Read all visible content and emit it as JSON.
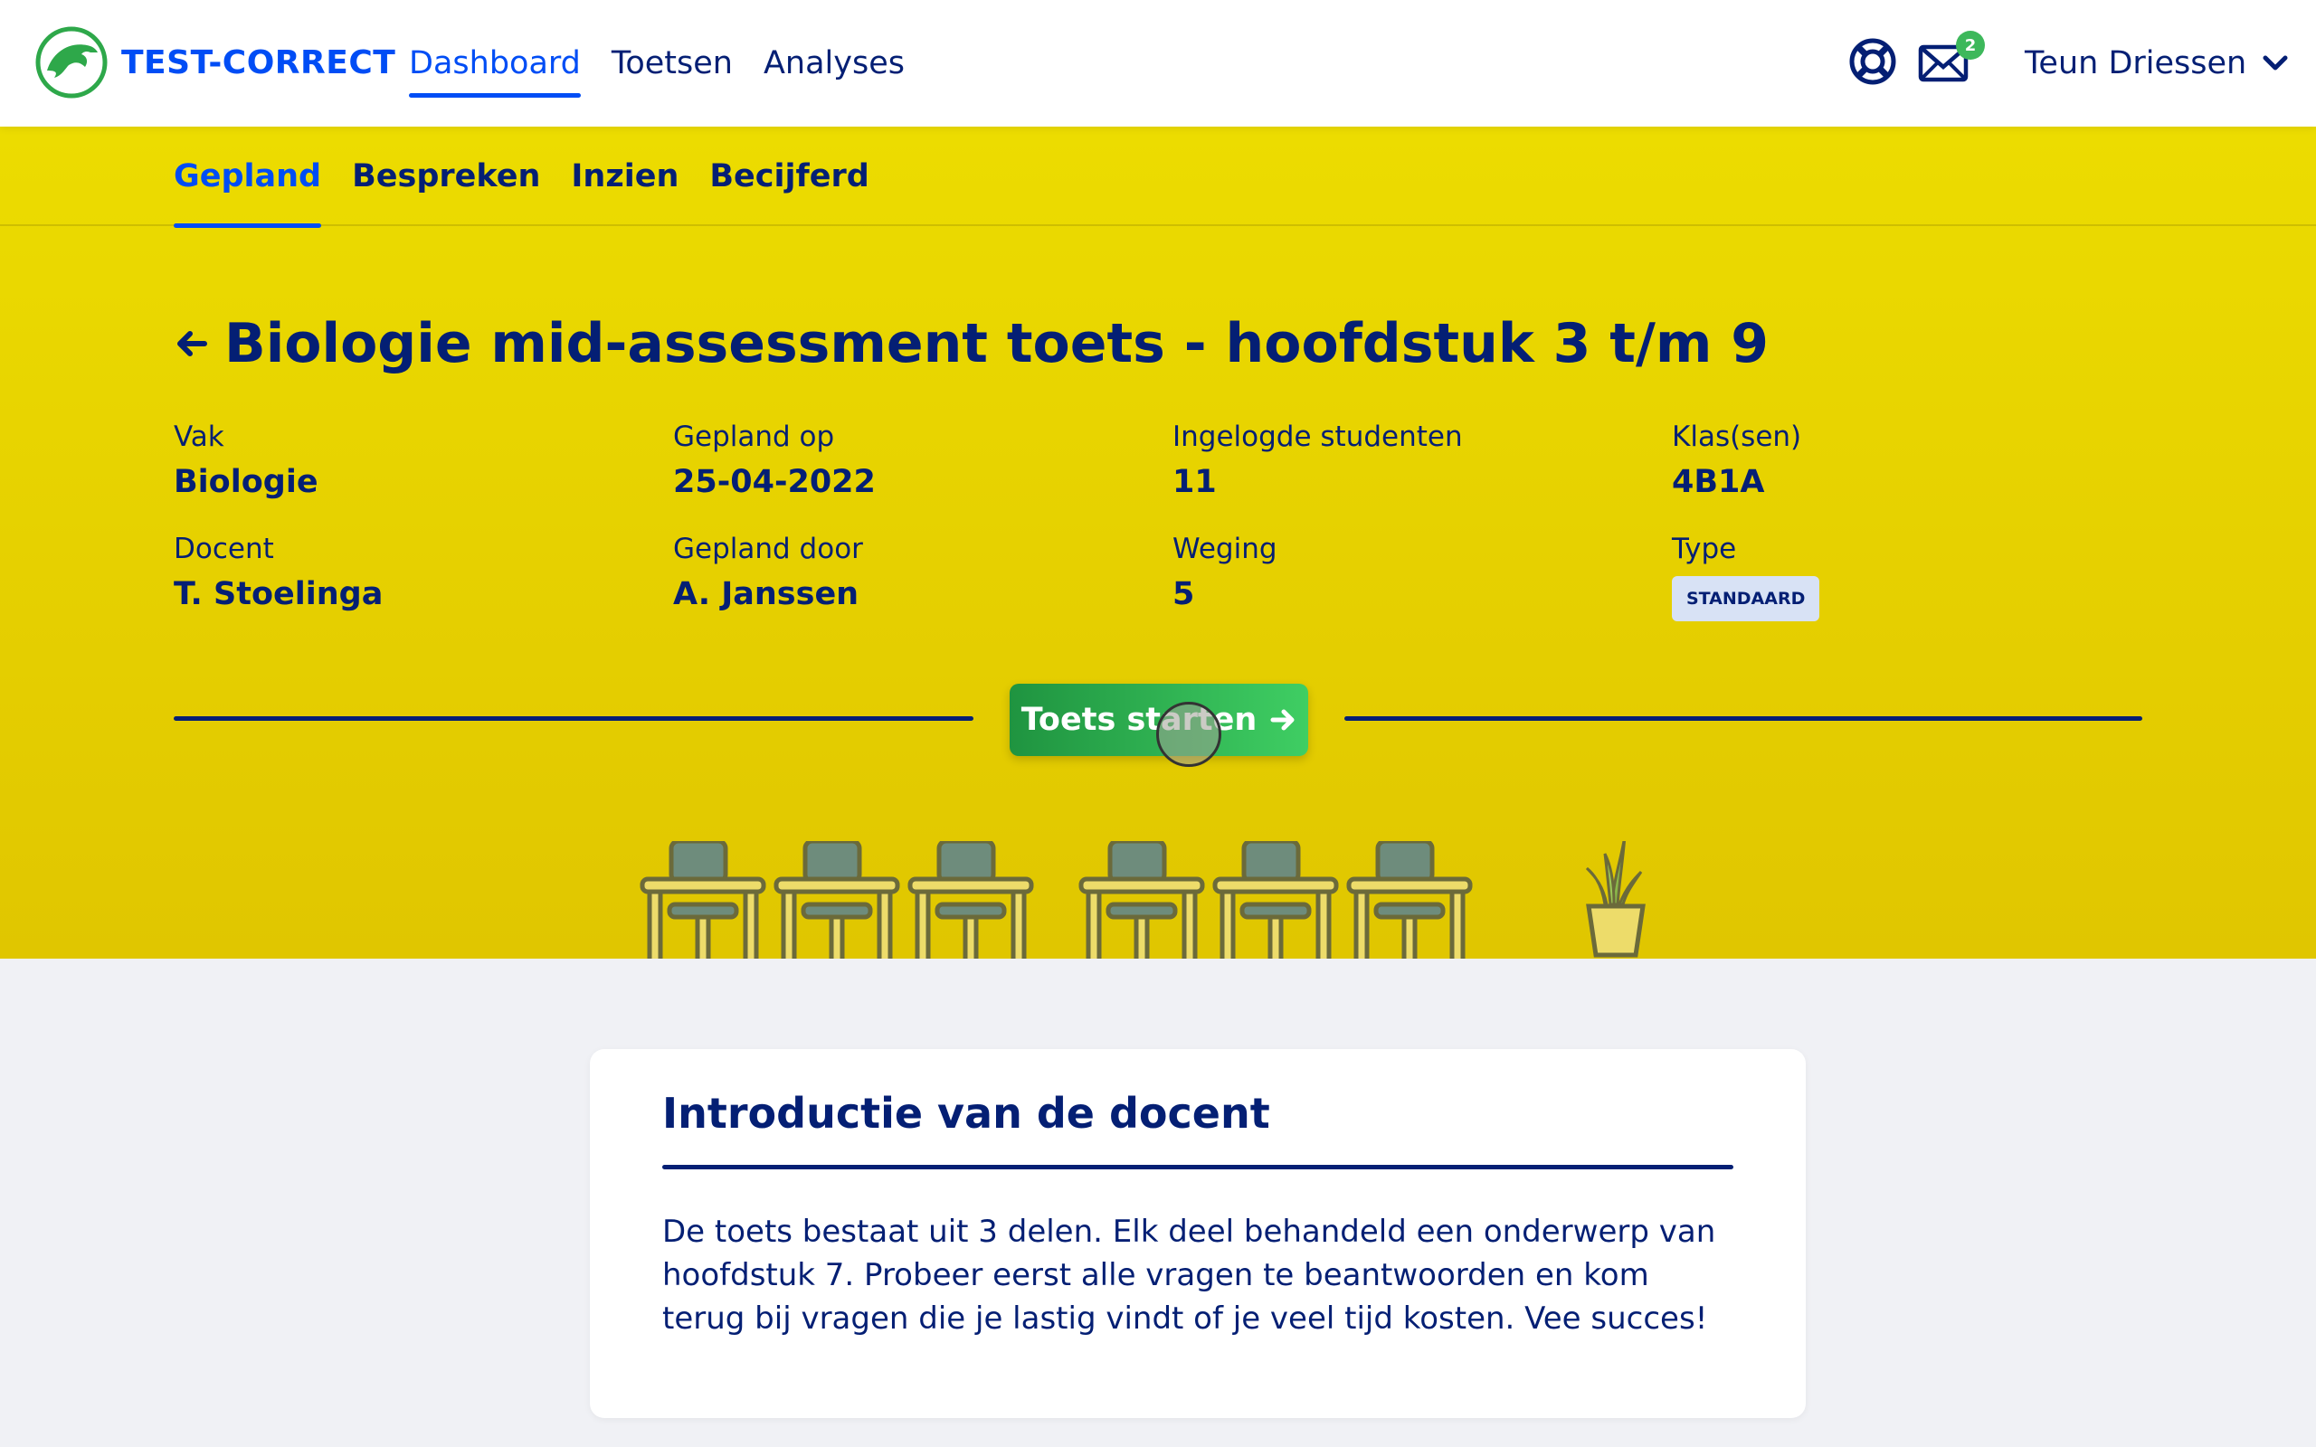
{
  "header": {
    "brand": "TEST-CORRECT",
    "nav": [
      {
        "label": "Dashboard",
        "active": true
      },
      {
        "label": "Toetsen",
        "active": false
      },
      {
        "label": "Analyses",
        "active": false
      }
    ],
    "icons": {
      "support": "lifebuoy-icon",
      "mail": "envelope-icon"
    },
    "mail_count": "2",
    "user_name": "Teun Driessen"
  },
  "subnav": [
    {
      "label": "Gepland",
      "active": true
    },
    {
      "label": "Bespreken",
      "active": false
    },
    {
      "label": "Inzien",
      "active": false
    },
    {
      "label": "Becijferd",
      "active": false
    }
  ],
  "test": {
    "title": "Biologie mid-assessment toets - hoofdstuk 3 t/m 9",
    "fields": [
      {
        "label": "Vak",
        "value": "Biologie"
      },
      {
        "label": "Gepland op",
        "value": "25-04-2022"
      },
      {
        "label": "Ingelogde studenten",
        "value": "11"
      },
      {
        "label": "Klas(sen)",
        "value": "4B1A"
      },
      {
        "label": "Docent",
        "value": "T. Stoelinga"
      },
      {
        "label": "Gepland door",
        "value": "A. Janssen"
      },
      {
        "label": "Weging",
        "value": "5"
      },
      {
        "label": "Type",
        "value": "STANDAARD"
      }
    ],
    "start_button": "Toets starten"
  },
  "intro": {
    "title": "Introductie van de docent",
    "body": "De toets bestaat uit 3 delen. Elk deel behandeld een onderwerp van hoofdstuk 7. Probeer eerst alle vragen te beantwoorden en kom terug bij vragen die je lastig vindt of je veel tijd kosten. Vee succes!"
  },
  "colors": {
    "brand_blue": "#004df5",
    "navy": "#041f74",
    "hero_yellow": "#ecdc00",
    "success_green": "#3fce63"
  }
}
